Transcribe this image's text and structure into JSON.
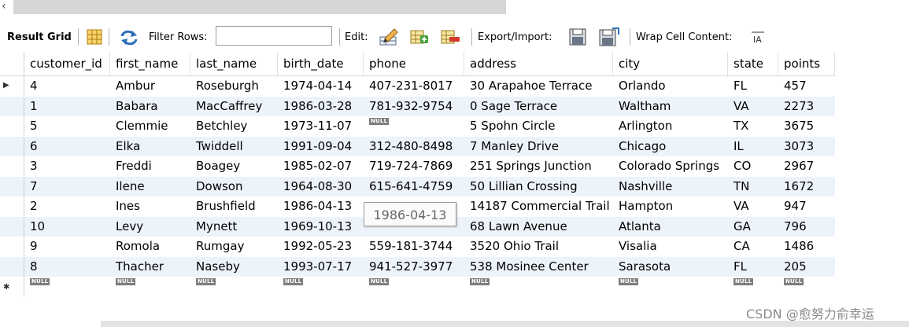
{
  "toolbar": {
    "result_grid": "Result Grid",
    "filter_rows": "Filter Rows:",
    "filter_value": "",
    "edit": "Edit:",
    "export_import": "Export/Import:",
    "wrap_cell": "Wrap Cell Content:"
  },
  "table": {
    "columns": [
      "customer_id",
      "first_name",
      "last_name",
      "birth_date",
      "phone",
      "address",
      "city",
      "state",
      "points"
    ],
    "rows": [
      [
        "4",
        "Ambur",
        "Roseburgh",
        "1974-04-14",
        "407-231-8017",
        "30 Arapahoe Terrace",
        "Orlando",
        "FL",
        "457"
      ],
      [
        "1",
        "Babara",
        "MacCaffrey",
        "1986-03-28",
        "781-932-9754",
        "0 Sage Terrace",
        "Waltham",
        "VA",
        "2273"
      ],
      [
        "5",
        "Clemmie",
        "Betchley",
        "1973-11-07",
        "NULL",
        "5 Spohn Circle",
        "Arlington",
        "TX",
        "3675"
      ],
      [
        "6",
        "Elka",
        "Twiddell",
        "1991-09-04",
        "312-480-8498",
        "7 Manley Drive",
        "Chicago",
        "IL",
        "3073"
      ],
      [
        "3",
        "Freddi",
        "Boagey",
        "1985-02-07",
        "719-724-7869",
        "251 Springs Junction",
        "Colorado Springs",
        "CO",
        "2967"
      ],
      [
        "7",
        "Ilene",
        "Dowson",
        "1964-08-30",
        "615-641-4759",
        "50 Lillian Crossing",
        "Nashville",
        "TN",
        "1672"
      ],
      [
        "2",
        "Ines",
        "Brushfield",
        "1986-04-13",
        "",
        "14187 Commercial Trail",
        "Hampton",
        "VA",
        "947"
      ],
      [
        "10",
        "Levy",
        "Mynett",
        "1969-10-13",
        "",
        "68 Lawn Avenue",
        "Atlanta",
        "GA",
        "796"
      ],
      [
        "9",
        "Romola",
        "Rumgay",
        "1992-05-23",
        "559-181-3744",
        "3520 Ohio Trail",
        "Visalia",
        "CA",
        "1486"
      ],
      [
        "8",
        "Thacher",
        "Naseby",
        "1993-07-17",
        "941-527-3977",
        "538 Mosinee Center",
        "Sarasota",
        "FL",
        "205"
      ]
    ],
    "new_row": [
      "NULL",
      "NULL",
      "NULL",
      "NULL",
      "NULL",
      "NULL",
      "NULL",
      "NULL",
      "NULL"
    ]
  },
  "tooltip": "1986-04-13",
  "watermark": "CSDN @愈努力俞幸运",
  "icons": {
    "grid_view": "grid-icon",
    "refresh": "refresh-icon",
    "edit_row": "edit-pencil-icon",
    "add_row": "add-row-icon",
    "delete_row": "delete-row-icon",
    "export": "export-icon",
    "import": "import-icon",
    "wrap": "wrap-icon"
  }
}
